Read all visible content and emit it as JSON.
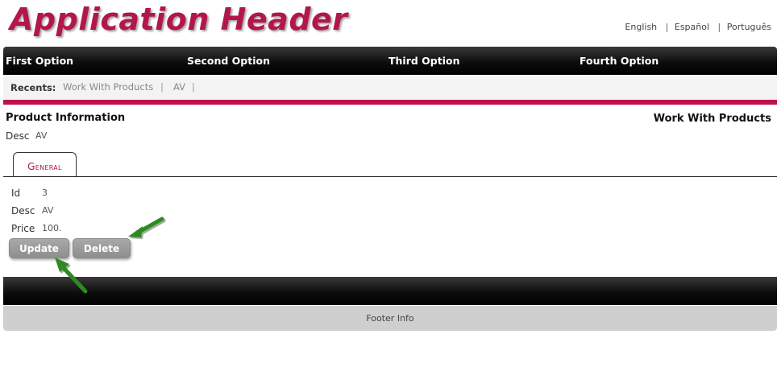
{
  "header": {
    "title": "Application Header",
    "languages": [
      "English",
      "Español",
      "Português"
    ],
    "title_color": "#b3174a"
  },
  "nav": {
    "items": [
      "First Option",
      "Second Option",
      "Third Option",
      "Fourth Option"
    ]
  },
  "recents": {
    "label": "Recents:",
    "items": [
      "Work With Products",
      "AV"
    ],
    "separator": "|"
  },
  "accent_color": "#c0124a",
  "product": {
    "section_title": "Product Information",
    "right_link": "Work With Products",
    "desc_label": "Desc",
    "desc_value": "AV"
  },
  "tabs": [
    {
      "label": "General",
      "active": true
    }
  ],
  "form": {
    "id_label": "Id",
    "id_value": "3",
    "desc_label": "Desc",
    "desc_value": "AV",
    "price_label": "Price",
    "price_value": "100."
  },
  "buttons": {
    "update": "Update",
    "delete": "Delete"
  },
  "footer": {
    "info": "Footer Info"
  },
  "annotations": {
    "arrow_color": "#2e8b22",
    "arrow_icon": "green-arrow-icon"
  }
}
